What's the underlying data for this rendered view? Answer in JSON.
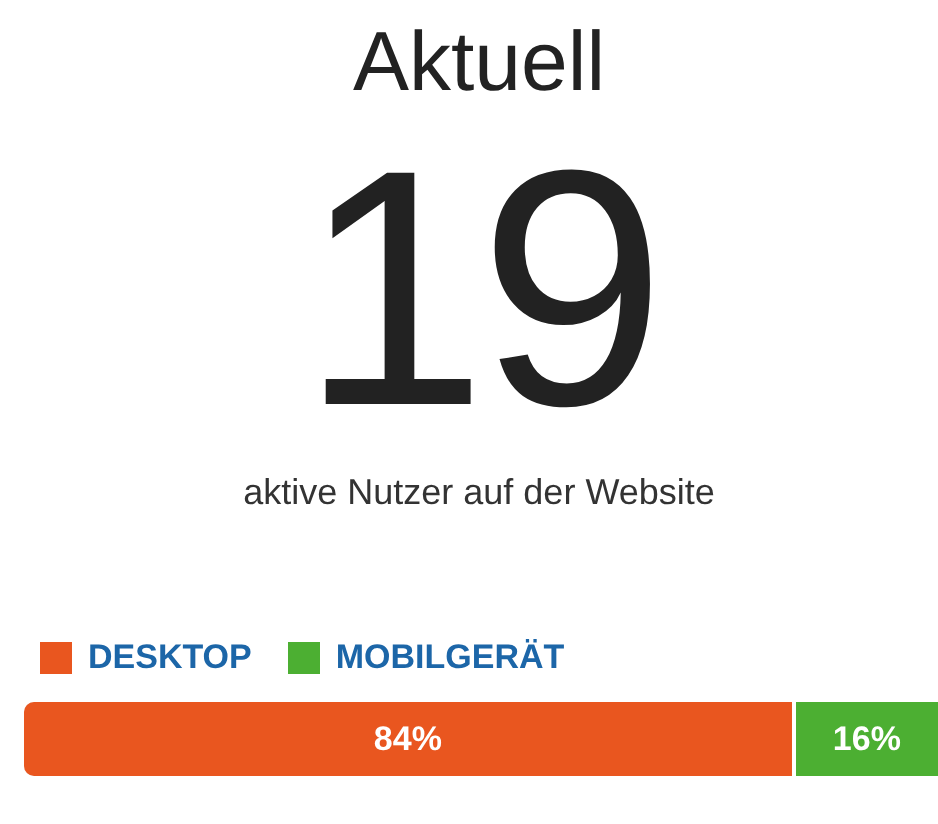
{
  "title": "Aktuell",
  "count": "19",
  "subtitle": "aktive Nutzer auf der Website",
  "legend": [
    {
      "label": "DESKTOP",
      "color": "#e9561f"
    },
    {
      "label": "MOBILGERÄT",
      "color": "#4caf32"
    }
  ],
  "bar": [
    {
      "label": "84%",
      "level": 0.84,
      "color": "#e9561f"
    },
    {
      "label": "16%",
      "level": 0.16,
      "color": "#4caf32"
    }
  ]
}
